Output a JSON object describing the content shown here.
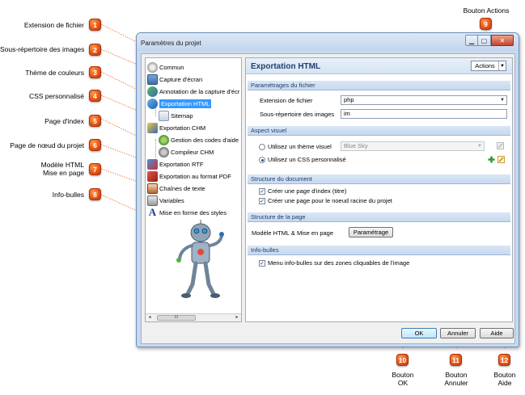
{
  "annotations": [
    {
      "n": "1",
      "label": "Extension de fichier"
    },
    {
      "n": "2",
      "label": "Sous-répertoire des images"
    },
    {
      "n": "3",
      "label": "Thème de couleurs"
    },
    {
      "n": "4",
      "label": "CSS personnalisé"
    },
    {
      "n": "5",
      "label": "Page d'index"
    },
    {
      "n": "6",
      "label": "Page de nœud du projet"
    },
    {
      "n": "7",
      "label_line1": "Modèle HTML",
      "label_line2": "Mise en page"
    },
    {
      "n": "8",
      "label": "Info-bulles"
    },
    {
      "n": "9",
      "label": "Bouton Actions"
    },
    {
      "n": "10",
      "label_line1": "Bouton",
      "label_line2": "OK"
    },
    {
      "n": "11",
      "label_line1": "Bouton",
      "label_line2": "Annuler"
    },
    {
      "n": "12",
      "label_line1": "Bouton",
      "label_line2": "Aide"
    }
  ],
  "window": {
    "title": "Paramètres du projet"
  },
  "tree": {
    "items": [
      {
        "label": "Commun"
      },
      {
        "label": "Capture d'écran"
      },
      {
        "label": "Annotation de la capture d'écr"
      },
      {
        "label": "Exportation HTML"
      },
      {
        "label": "Sitemap"
      },
      {
        "label": "Exportation CHM"
      },
      {
        "label": "Gestion des codes d'aide"
      },
      {
        "label": "Compileur CHM"
      },
      {
        "label": "Exportation RTF"
      },
      {
        "label": "Exportation au format PDF"
      },
      {
        "label": "Chaînes de texte"
      },
      {
        "label": "Variables"
      },
      {
        "label": "Mise en forme des styles"
      }
    ],
    "scroll_thumb": "III"
  },
  "panel": {
    "title": "Exportation HTML",
    "actions_label": "Actions",
    "sections": {
      "files": "Paramétrages du fichier",
      "visual": "Aspect visuel",
      "structure": "Structure du document",
      "page_structure": "Structure de la page",
      "tooltips": "Info-bulles"
    },
    "file_ext_label": "Extension de fichier",
    "file_ext_value": "php",
    "images_dir_label": "Sous-répertoire des images",
    "images_dir_value": "im",
    "theme_radio_label": "Utilisez un thème visuel",
    "theme_value": "Blue Sky",
    "css_radio_label": "Utilisez un CSS personnalisé",
    "index_check_label": "Créer une page d'index (titre)",
    "root_check_label": "Créer une page pour le noeud racine du projet",
    "template_label": "Modèle HTML & Mise en page",
    "template_button": "Paramétrage",
    "tooltips_check_label": "Menu info-bulles sur des zones cliquables de l'image"
  },
  "buttons": {
    "ok": "OK",
    "cancel": "Annuler",
    "help": "Aide"
  },
  "colors": {
    "badge": "#e8561a",
    "selection": "#3399ff",
    "section_text": "#1e3c6b",
    "panel_title": "#1f3f6e"
  }
}
